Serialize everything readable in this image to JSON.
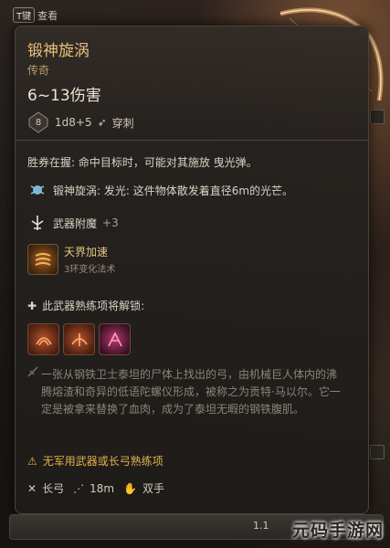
{
  "top_hint": {
    "key": "T键",
    "label": "查看"
  },
  "item": {
    "name": "锻神旋涡",
    "rarity": "传奇",
    "damage": "6~13伤害",
    "dice_badge": "8",
    "dice_text": "1d8+5",
    "damage_type": "穿刺"
  },
  "effects": [
    {
      "text": "胜券在握: 命中目标时，可能对其施放 曳光弹。"
    },
    {
      "text": "锻神旋涡: 发光: 这件物体散发着直径6m的光芒。"
    }
  ],
  "enchant": {
    "label": "武器附魔",
    "value": "+3"
  },
  "spell": {
    "name": "天界加速",
    "sub": "3环变化法术"
  },
  "proficiency_header": "此武器熟练项将解锁:",
  "lore": "一张从钢铁卫士泰坦的尸体上找出的弓，由机械巨人体内的沸腾熔渣和奇异的低语陀螺仪形成，被称之为贡特·马以尔。它一定是被拿来替换了血肉，成为了泰坦无暇的钢铁腹肌。",
  "warning": "无军用武器或长弓熟练项",
  "footer": {
    "weapon_type": "长弓",
    "range": "18m",
    "hands": "双手"
  },
  "bottom": {
    "version": "1.1",
    "watermark": "元码手游网"
  },
  "colors": {
    "title": "#e8c078",
    "warning": "#e2b24a",
    "accent_text": "#e6c581"
  }
}
